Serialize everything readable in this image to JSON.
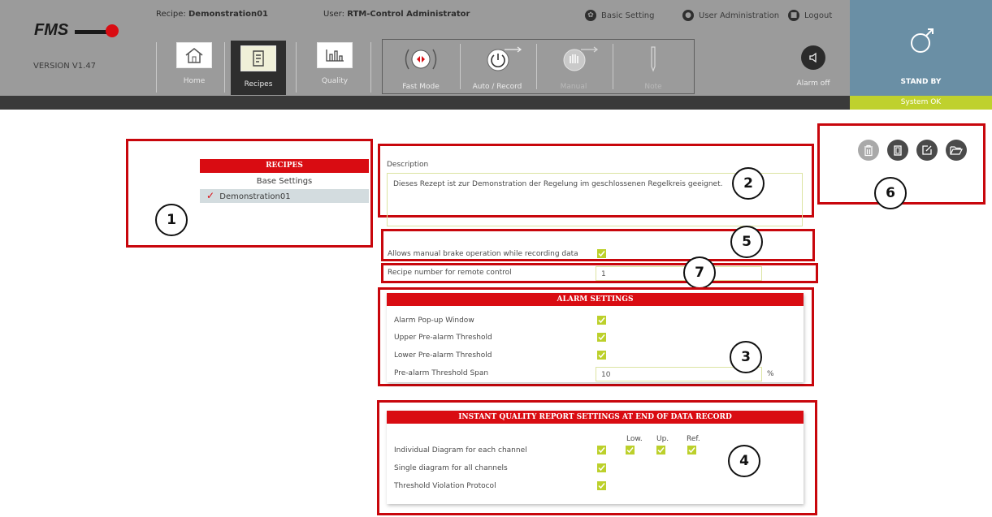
{
  "app": {
    "logo_text": "FMS",
    "version": "VERSION V1.47",
    "recipe_label": "Recipe:",
    "recipe_value": "Demonstration01",
    "user_label": "User:",
    "user_value": "RTM-Control Administrator"
  },
  "toplinks": [
    {
      "label": "Basic Setting",
      "icon": "gear-icon"
    },
    {
      "label": "User Administration",
      "icon": "user-icon"
    },
    {
      "label": "Logout",
      "icon": "lock-icon"
    }
  ],
  "nav": [
    {
      "label": "Home",
      "icon": "home-icon"
    },
    {
      "label": "Recipes",
      "icon": "recipe-scroll-icon",
      "active": true
    },
    {
      "label": "Quality",
      "icon": "bar-chart-icon"
    }
  ],
  "modes": [
    {
      "label": "Fast Mode",
      "icon": "fast-mode-icon"
    },
    {
      "label": "Auto / Record",
      "icon": "power-record-icon"
    },
    {
      "label": "Manual",
      "icon": "manual-icon",
      "disabled": true
    },
    {
      "label": "Note",
      "icon": "pen-icon",
      "disabled": true
    }
  ],
  "alarm": {
    "label": "Alarm off",
    "icon": "speaker-mute-icon"
  },
  "status": {
    "label": "STAND BY",
    "icon": "standby-icon",
    "system": "System OK",
    "color": "#6a8fa5",
    "ok_color": "#bfd12d"
  },
  "recipes": {
    "title": "RECIPES",
    "items": [
      {
        "label": "Base Settings",
        "selected": false
      },
      {
        "label": "Demonstration01",
        "selected": true
      }
    ]
  },
  "description": {
    "label": "Description",
    "text": "Dieses Rezept ist zur Demonstration der Regelung im geschlossenen Regelkreis geeignet."
  },
  "options": {
    "manual_brake_label": "Allows manual brake operation while recording data",
    "manual_brake_checked": true,
    "recipe_number_label": "Recipe number for remote control",
    "recipe_number_value": "1"
  },
  "alarm_settings": {
    "title": "ALARM SETTINGS",
    "rows": [
      {
        "label": "Alarm Pop-up Window",
        "checked": true
      },
      {
        "label": "Upper Pre-alarm Threshold",
        "checked": true
      },
      {
        "label": "Lower Pre-alarm Threshold",
        "checked": true
      }
    ],
    "span_label": "Pre-alarm Threshold Span",
    "span_value": "10",
    "span_unit": "%"
  },
  "quality_report": {
    "title": "INSTANT QUALITY REPORT SETTINGS AT END OF DATA RECORD",
    "col_low": "Low.",
    "col_up": "Up.",
    "col_ref": "Ref.",
    "rows": [
      {
        "label": "Individual Diagram for each channel",
        "checked": true
      },
      {
        "label": "Single diagram for all channels",
        "checked": true
      },
      {
        "label": "Threshold Violation Protocol",
        "checked": true
      }
    ]
  },
  "toolbar": [
    {
      "icon": "trash-icon",
      "disabled": true
    },
    {
      "icon": "copy-icon"
    },
    {
      "icon": "edit-icon"
    },
    {
      "icon": "folder-open-icon"
    }
  ],
  "annotations": [
    "1",
    "2",
    "3",
    "4",
    "5",
    "6",
    "7"
  ],
  "accent": "#d90c12"
}
